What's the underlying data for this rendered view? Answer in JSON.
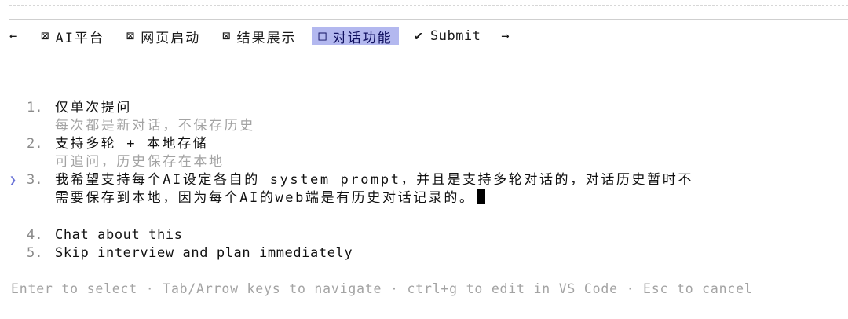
{
  "nav": {
    "back_arrow": "←",
    "forward_arrow": "→",
    "tabs": [
      {
        "mark": "⊠",
        "label": "AI平台"
      },
      {
        "mark": "⊠",
        "label": "网页启动"
      },
      {
        "mark": "⊠",
        "label": "结果展示"
      },
      {
        "mark": "□",
        "label": "对话功能"
      },
      {
        "mark": "✔",
        "label": "Submit"
      }
    ]
  },
  "options": [
    {
      "num": "1.",
      "label": "仅单次提问",
      "desc": "每次都是新对话，不保存历史"
    },
    {
      "num": "2.",
      "label": "支持多轮 + 本地存储",
      "desc": "可追问，历史保存在本地"
    },
    {
      "num": "3.",
      "pointer": "❯",
      "label_line1": "我希望支持每个AI设定各自的 system prompt，并且是支持多轮对话的，对话历史暂时不",
      "label_line2": "需要保存到本地，因为每个AI的web端是有历史对话记录的。"
    },
    {
      "num": "4.",
      "label": "Chat about this"
    },
    {
      "num": "5.",
      "label": "Skip interview and plan immediately"
    }
  ],
  "footer": "Enter to select · Tab/Arrow keys to navigate · ctrl+g to edit in VS Code · Esc to cancel",
  "colors": {
    "active_tab_bg": "#b3b8ef",
    "pointer": "#6b74d8",
    "muted_text": "#a3a3a3"
  }
}
